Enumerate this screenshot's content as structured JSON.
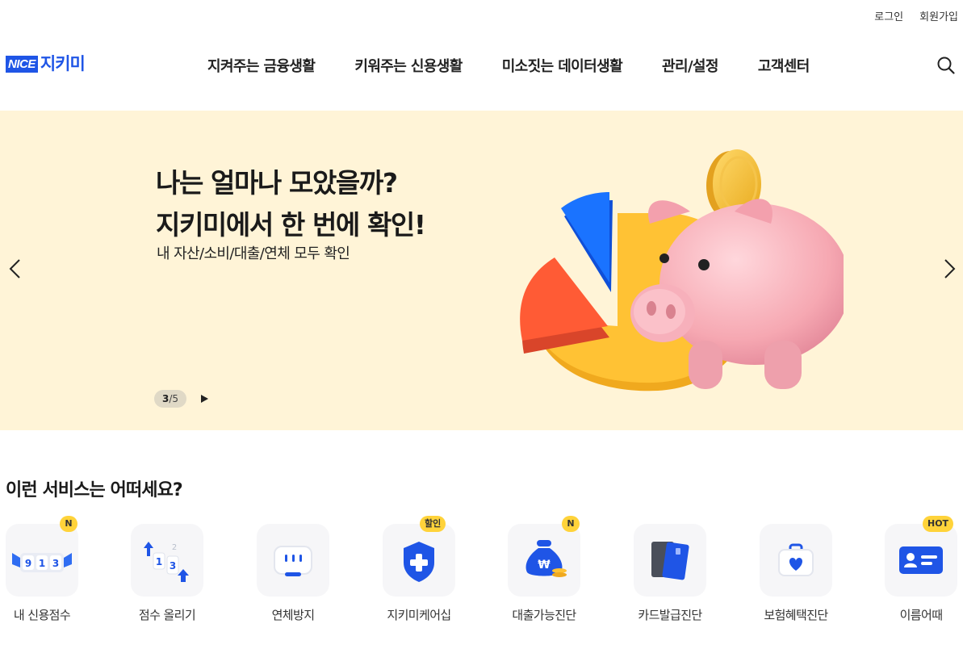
{
  "util_links": {
    "login": "로그인",
    "signup": "회원가입"
  },
  "logo": {
    "nice": "NICE",
    "name": "지키미"
  },
  "nav": [
    {
      "label": "지켜주는 금융생활"
    },
    {
      "label": "키워주는 신용생활"
    },
    {
      "label": "미소짓는 데이터생활"
    },
    {
      "label": "관리/설정"
    },
    {
      "label": "고객센터"
    }
  ],
  "banner": {
    "headline_1": "나는 얼마나 모았을까?",
    "headline_2": "지키미에서 한 번에 확인!",
    "subline": "내 자산/소비/대출/연체 모두 확인",
    "current": "3",
    "separator": "/",
    "total": "5",
    "background": "#fff4d7"
  },
  "services": {
    "title": "이런 서비스는 어떠세요?",
    "items": [
      {
        "label": "내 신용점수",
        "badge": "N",
        "icon": "credit-score-dial-icon"
      },
      {
        "label": "점수 올리기",
        "badge": "",
        "icon": "score-up-icon"
      },
      {
        "label": "연체방지",
        "badge": "",
        "icon": "calendar-alert-icon"
      },
      {
        "label": "지키미케어십",
        "badge": "할인",
        "icon": "shield-plus-icon"
      },
      {
        "label": "대출가능진단",
        "badge": "N",
        "icon": "money-bag-icon"
      },
      {
        "label": "카드발급진단",
        "badge": "",
        "icon": "cards-icon"
      },
      {
        "label": "보험혜택진단",
        "badge": "",
        "icon": "heart-kit-icon"
      },
      {
        "label": "이름어때",
        "badge": "HOT",
        "icon": "id-card-icon"
      }
    ]
  },
  "colors": {
    "brand": "#1f55e6",
    "badge": "#ffd33a",
    "text": "#222222"
  }
}
